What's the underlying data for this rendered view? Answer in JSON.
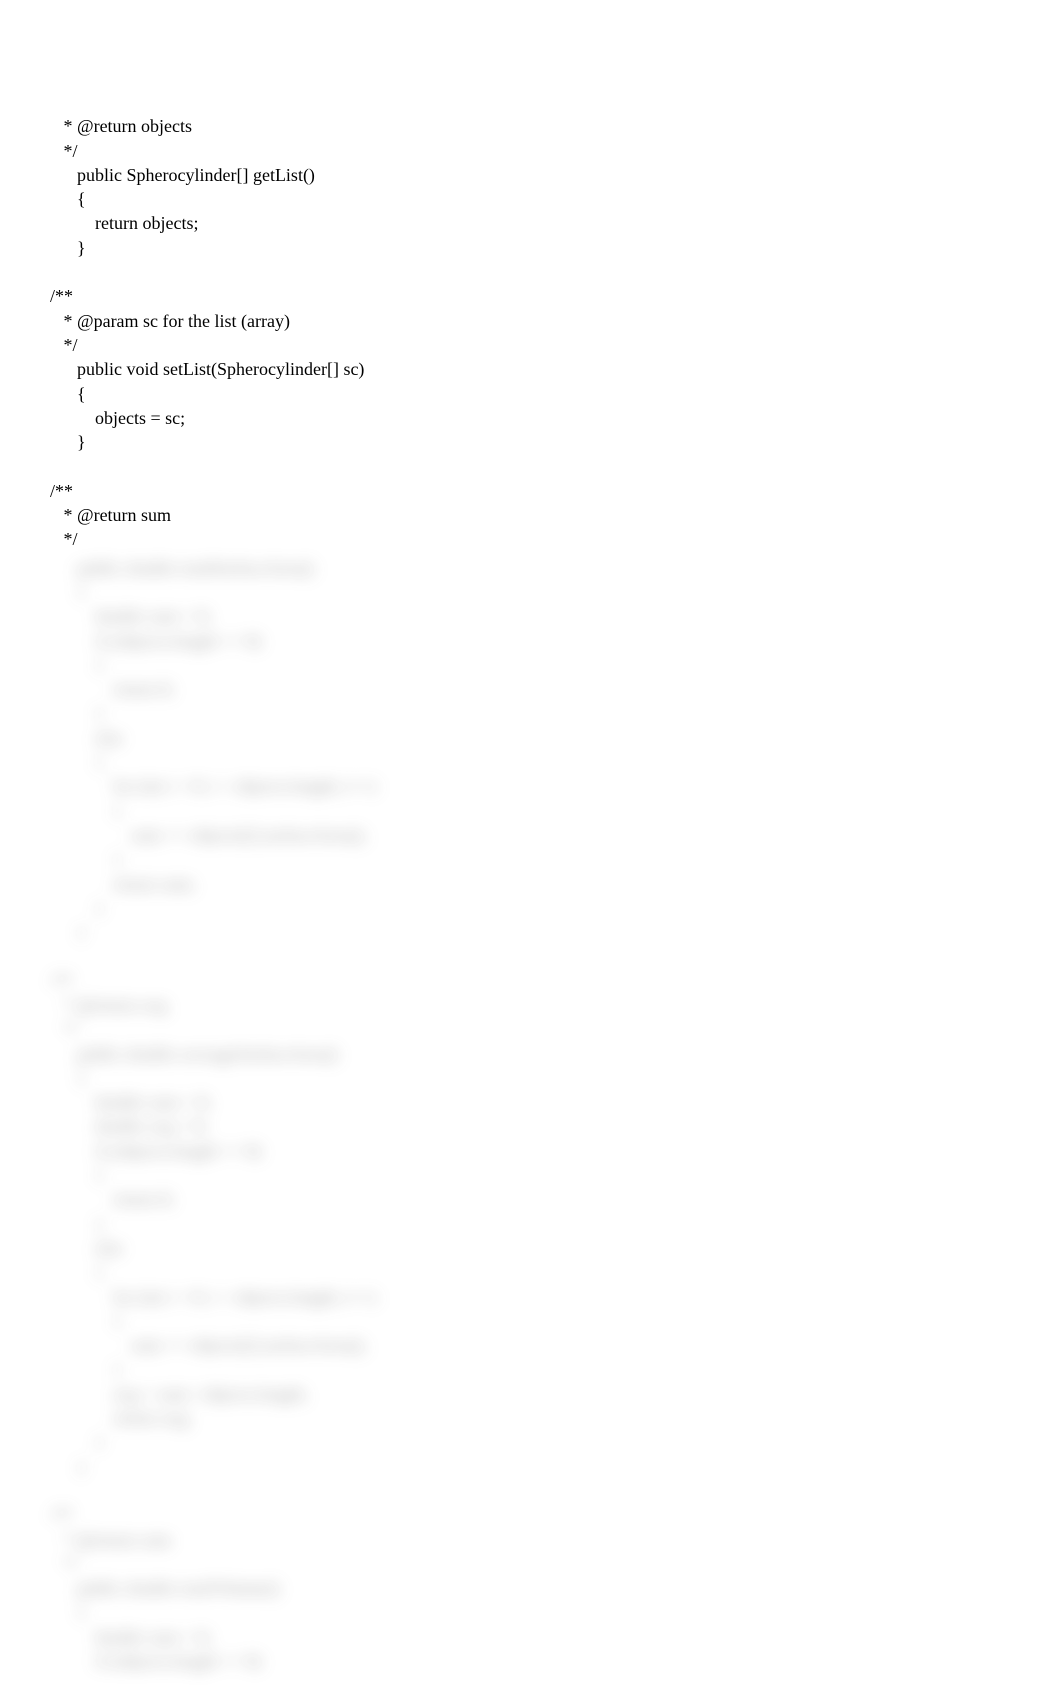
{
  "code": {
    "section1": {
      "line1": "   * @return objects",
      "line2": "   */",
      "line3": "      public Spherocylinder[] getList()",
      "line4": "      {",
      "line5": "          return objects;",
      "line6": "      }",
      "blank1": "",
      "line7": "/**",
      "line8": "   * @param sc for the list (array)",
      "line9": "   */",
      "line10": "      public void setList(Spherocylinder[] sc)",
      "line11": "      {",
      "line12": "          objects = sc;",
      "line13": "      }",
      "blank2": "",
      "line14": "/**",
      "line15": "   * @return sum",
      "line16": "   */"
    },
    "blurred": "      public double totalSurfaceArea()\n      {\n          double sum = 0;\n          if (objects.length == 0)\n          {\n              return 0;\n          }\n          else\n          {\n              for (int i = 0; i < objects.length; i++)\n              {\n                  sum += objects[i].surfaceArea();\n              }\n              return sum;\n          }\n      }\n\n/**\n   * @return avg\n   */\n      public double averageSurfaceArea()\n      {\n          double sum = 0;\n          double avg = 0;\n          if (objects.length == 0)\n          {\n              return 0;\n          }\n          else\n          {\n              for (int i = 0; i < objects.length; i++)\n              {\n                  sum += objects[i].surfaceArea();\n              }\n              avg = sum / objects.length;\n              return avg;\n          }\n      }\n\n/**\n   * @return sum\n   */\n      public double totalVolume()\n      {\n          double sum = 0;\n          if (objects.length == 0)"
  }
}
